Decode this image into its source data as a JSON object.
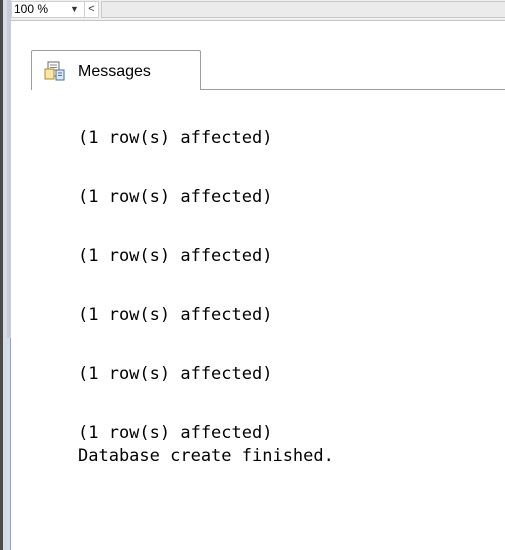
{
  "toolbar": {
    "zoom_value": "100 %",
    "zoom_dropdown_arrow": "▼",
    "scroll_left_glyph": "<"
  },
  "tabs": {
    "messages": {
      "label": "Messages",
      "icon": "messages-document-icon"
    }
  },
  "messages": [
    "(1 row(s) affected)",
    "(1 row(s) affected)",
    "(1 row(s) affected)",
    "(1 row(s) affected)",
    "(1 row(s) affected)",
    "(1 row(s) affected)",
    "Database create finished."
  ],
  "colors": {
    "splitter": "#d6dbe9",
    "tab_border": "#9e9e9e",
    "text": "#000000"
  }
}
